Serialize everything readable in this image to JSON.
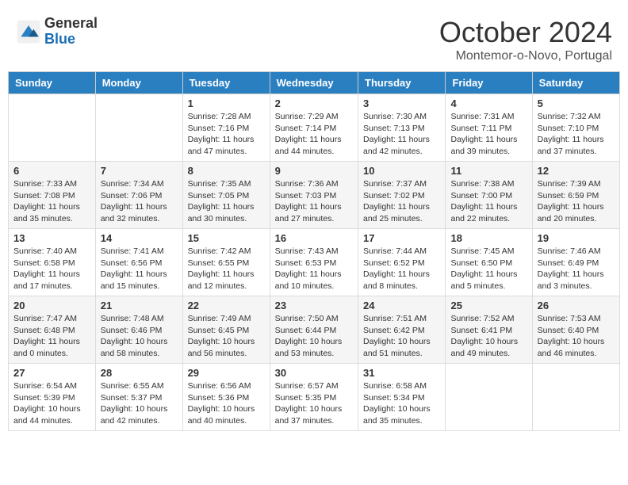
{
  "header": {
    "logo_general": "General",
    "logo_blue": "Blue",
    "month_title": "October 2024",
    "location": "Montemor-o-Novo, Portugal"
  },
  "days_of_week": [
    "Sunday",
    "Monday",
    "Tuesday",
    "Wednesday",
    "Thursday",
    "Friday",
    "Saturday"
  ],
  "weeks": [
    [
      {
        "day": "",
        "info": ""
      },
      {
        "day": "",
        "info": ""
      },
      {
        "day": "1",
        "info": "Sunrise: 7:28 AM\nSunset: 7:16 PM\nDaylight: 11 hours and 47 minutes."
      },
      {
        "day": "2",
        "info": "Sunrise: 7:29 AM\nSunset: 7:14 PM\nDaylight: 11 hours and 44 minutes."
      },
      {
        "day": "3",
        "info": "Sunrise: 7:30 AM\nSunset: 7:13 PM\nDaylight: 11 hours and 42 minutes."
      },
      {
        "day": "4",
        "info": "Sunrise: 7:31 AM\nSunset: 7:11 PM\nDaylight: 11 hours and 39 minutes."
      },
      {
        "day": "5",
        "info": "Sunrise: 7:32 AM\nSunset: 7:10 PM\nDaylight: 11 hours and 37 minutes."
      }
    ],
    [
      {
        "day": "6",
        "info": "Sunrise: 7:33 AM\nSunset: 7:08 PM\nDaylight: 11 hours and 35 minutes."
      },
      {
        "day": "7",
        "info": "Sunrise: 7:34 AM\nSunset: 7:06 PM\nDaylight: 11 hours and 32 minutes."
      },
      {
        "day": "8",
        "info": "Sunrise: 7:35 AM\nSunset: 7:05 PM\nDaylight: 11 hours and 30 minutes."
      },
      {
        "day": "9",
        "info": "Sunrise: 7:36 AM\nSunset: 7:03 PM\nDaylight: 11 hours and 27 minutes."
      },
      {
        "day": "10",
        "info": "Sunrise: 7:37 AM\nSunset: 7:02 PM\nDaylight: 11 hours and 25 minutes."
      },
      {
        "day": "11",
        "info": "Sunrise: 7:38 AM\nSunset: 7:00 PM\nDaylight: 11 hours and 22 minutes."
      },
      {
        "day": "12",
        "info": "Sunrise: 7:39 AM\nSunset: 6:59 PM\nDaylight: 11 hours and 20 minutes."
      }
    ],
    [
      {
        "day": "13",
        "info": "Sunrise: 7:40 AM\nSunset: 6:58 PM\nDaylight: 11 hours and 17 minutes."
      },
      {
        "day": "14",
        "info": "Sunrise: 7:41 AM\nSunset: 6:56 PM\nDaylight: 11 hours and 15 minutes."
      },
      {
        "day": "15",
        "info": "Sunrise: 7:42 AM\nSunset: 6:55 PM\nDaylight: 11 hours and 12 minutes."
      },
      {
        "day": "16",
        "info": "Sunrise: 7:43 AM\nSunset: 6:53 PM\nDaylight: 11 hours and 10 minutes."
      },
      {
        "day": "17",
        "info": "Sunrise: 7:44 AM\nSunset: 6:52 PM\nDaylight: 11 hours and 8 minutes."
      },
      {
        "day": "18",
        "info": "Sunrise: 7:45 AM\nSunset: 6:50 PM\nDaylight: 11 hours and 5 minutes."
      },
      {
        "day": "19",
        "info": "Sunrise: 7:46 AM\nSunset: 6:49 PM\nDaylight: 11 hours and 3 minutes."
      }
    ],
    [
      {
        "day": "20",
        "info": "Sunrise: 7:47 AM\nSunset: 6:48 PM\nDaylight: 11 hours and 0 minutes."
      },
      {
        "day": "21",
        "info": "Sunrise: 7:48 AM\nSunset: 6:46 PM\nDaylight: 10 hours and 58 minutes."
      },
      {
        "day": "22",
        "info": "Sunrise: 7:49 AM\nSunset: 6:45 PM\nDaylight: 10 hours and 56 minutes."
      },
      {
        "day": "23",
        "info": "Sunrise: 7:50 AM\nSunset: 6:44 PM\nDaylight: 10 hours and 53 minutes."
      },
      {
        "day": "24",
        "info": "Sunrise: 7:51 AM\nSunset: 6:42 PM\nDaylight: 10 hours and 51 minutes."
      },
      {
        "day": "25",
        "info": "Sunrise: 7:52 AM\nSunset: 6:41 PM\nDaylight: 10 hours and 49 minutes."
      },
      {
        "day": "26",
        "info": "Sunrise: 7:53 AM\nSunset: 6:40 PM\nDaylight: 10 hours and 46 minutes."
      }
    ],
    [
      {
        "day": "27",
        "info": "Sunrise: 6:54 AM\nSunset: 5:39 PM\nDaylight: 10 hours and 44 minutes."
      },
      {
        "day": "28",
        "info": "Sunrise: 6:55 AM\nSunset: 5:37 PM\nDaylight: 10 hours and 42 minutes."
      },
      {
        "day": "29",
        "info": "Sunrise: 6:56 AM\nSunset: 5:36 PM\nDaylight: 10 hours and 40 minutes."
      },
      {
        "day": "30",
        "info": "Sunrise: 6:57 AM\nSunset: 5:35 PM\nDaylight: 10 hours and 37 minutes."
      },
      {
        "day": "31",
        "info": "Sunrise: 6:58 AM\nSunset: 5:34 PM\nDaylight: 10 hours and 35 minutes."
      },
      {
        "day": "",
        "info": ""
      },
      {
        "day": "",
        "info": ""
      }
    ]
  ]
}
